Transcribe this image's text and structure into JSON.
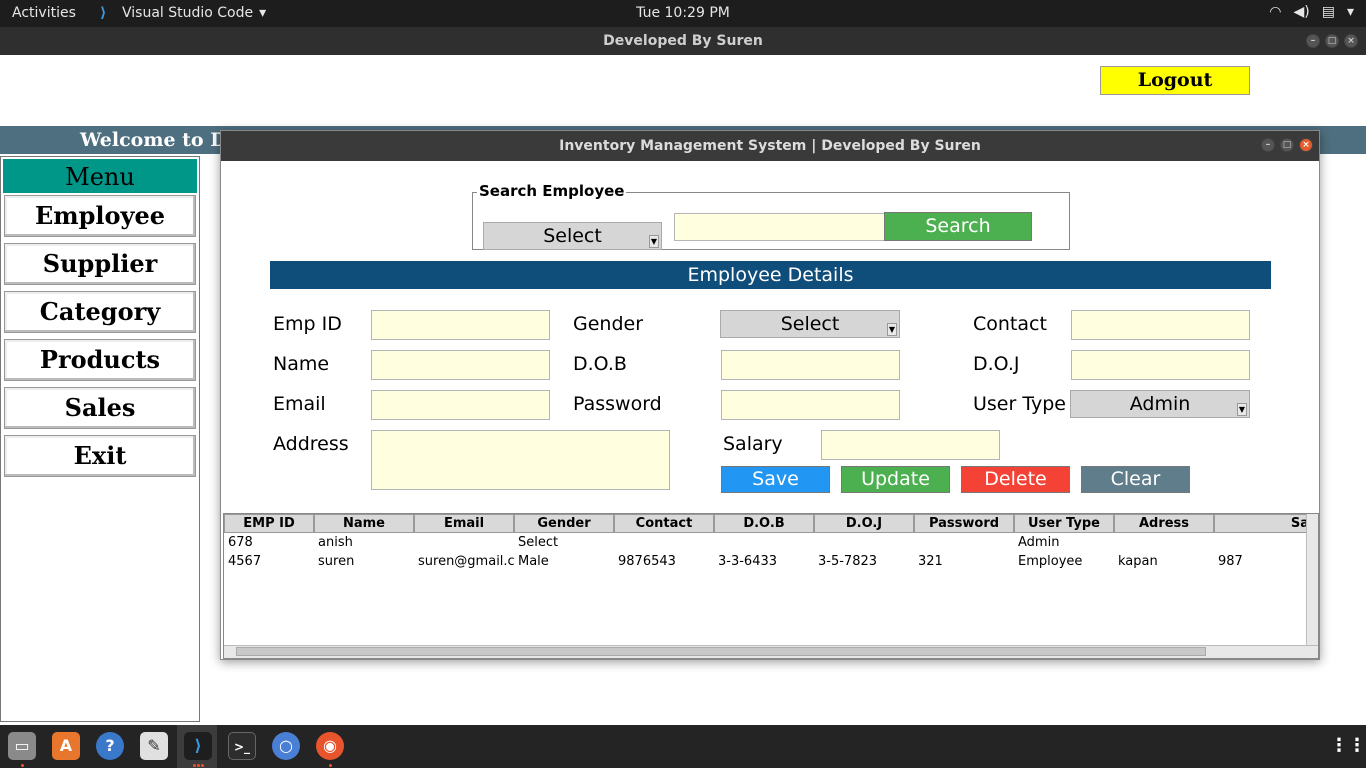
{
  "topbar": {
    "activities": "Activities",
    "app_name": "Visual Studio Code",
    "clock": "Tue 10:29 PM",
    "tray": [
      "wifi-icon",
      "volume-icon",
      "clipboard-icon",
      "chevron-down-icon"
    ]
  },
  "outer_window": {
    "title": "Developed By Suren",
    "logout_label": "Logout",
    "welcome_text": "Welcome to Desl"
  },
  "menu": {
    "title": "Menu",
    "items": [
      "Employee",
      "Supplier",
      "Category",
      "Products",
      "Sales",
      "Exit"
    ]
  },
  "inner_window": {
    "title": "Inventory Management System | Developed By Suren"
  },
  "search": {
    "legend": "Search Employee",
    "by_value": "Select",
    "text_value": "",
    "button_label": "Search"
  },
  "details": {
    "heading": "Employee Details",
    "labels": {
      "emp_id": "Emp ID",
      "gender": "Gender",
      "contact": "Contact",
      "name": "Name",
      "dob": "D.O.B",
      "doj": "D.O.J",
      "email": "Email",
      "password": "Password",
      "user_type": "User Type",
      "address": "Address",
      "salary": "Salary"
    },
    "gender_value": "Select",
    "user_type_value": "Admin"
  },
  "buttons": {
    "save": "Save",
    "update": "Update",
    "delete": "Delete",
    "clear": "Clear"
  },
  "colors": {
    "save": "#2196f3",
    "update": "#4caf50",
    "delete": "#f44336",
    "clear": "#607d8b",
    "search": "#4caf50",
    "band": "#0f4d7a",
    "menu_title": "#009688",
    "logout": "#ffff00",
    "field": "#ffffe0"
  },
  "table": {
    "headers": [
      "EMP ID",
      "Name",
      "Email",
      "Gender",
      "Contact",
      "D.O.B",
      "D.O.J",
      "Password",
      "User Type",
      "Adress",
      "Sa"
    ],
    "rows": [
      [
        "678",
        "anish",
        "",
        "Select",
        "",
        "",
        "",
        "",
        "Admin",
        "",
        ""
      ],
      [
        "4567",
        "suren",
        "suren@gmail.c",
        "Male",
        "9876543",
        "3-3-6433",
        "3-5-7823",
        "321",
        "Employee",
        "kapan",
        "987"
      ]
    ]
  },
  "dock": {
    "icons": [
      "files-icon",
      "software-center-icon",
      "help-icon",
      "text-editor-icon",
      "vscode-icon",
      "terminal-icon",
      "chromium-icon",
      "firefox-icon",
      "app-grid-icon"
    ]
  }
}
